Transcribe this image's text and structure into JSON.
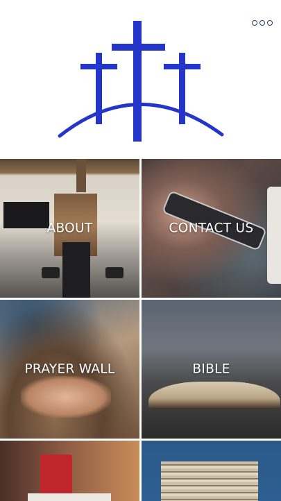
{
  "header": {
    "logo_icon": "three-crosses-on-hill-icon",
    "logo_color": "#2436c9",
    "menu_icon": "more-options-icon"
  },
  "tiles": [
    {
      "label": "ABOUT"
    },
    {
      "label": "CONTACT US"
    },
    {
      "label": "PRAYER WALL"
    },
    {
      "label": "BIBLE"
    },
    {
      "label": ""
    },
    {
      "label": ""
    }
  ]
}
